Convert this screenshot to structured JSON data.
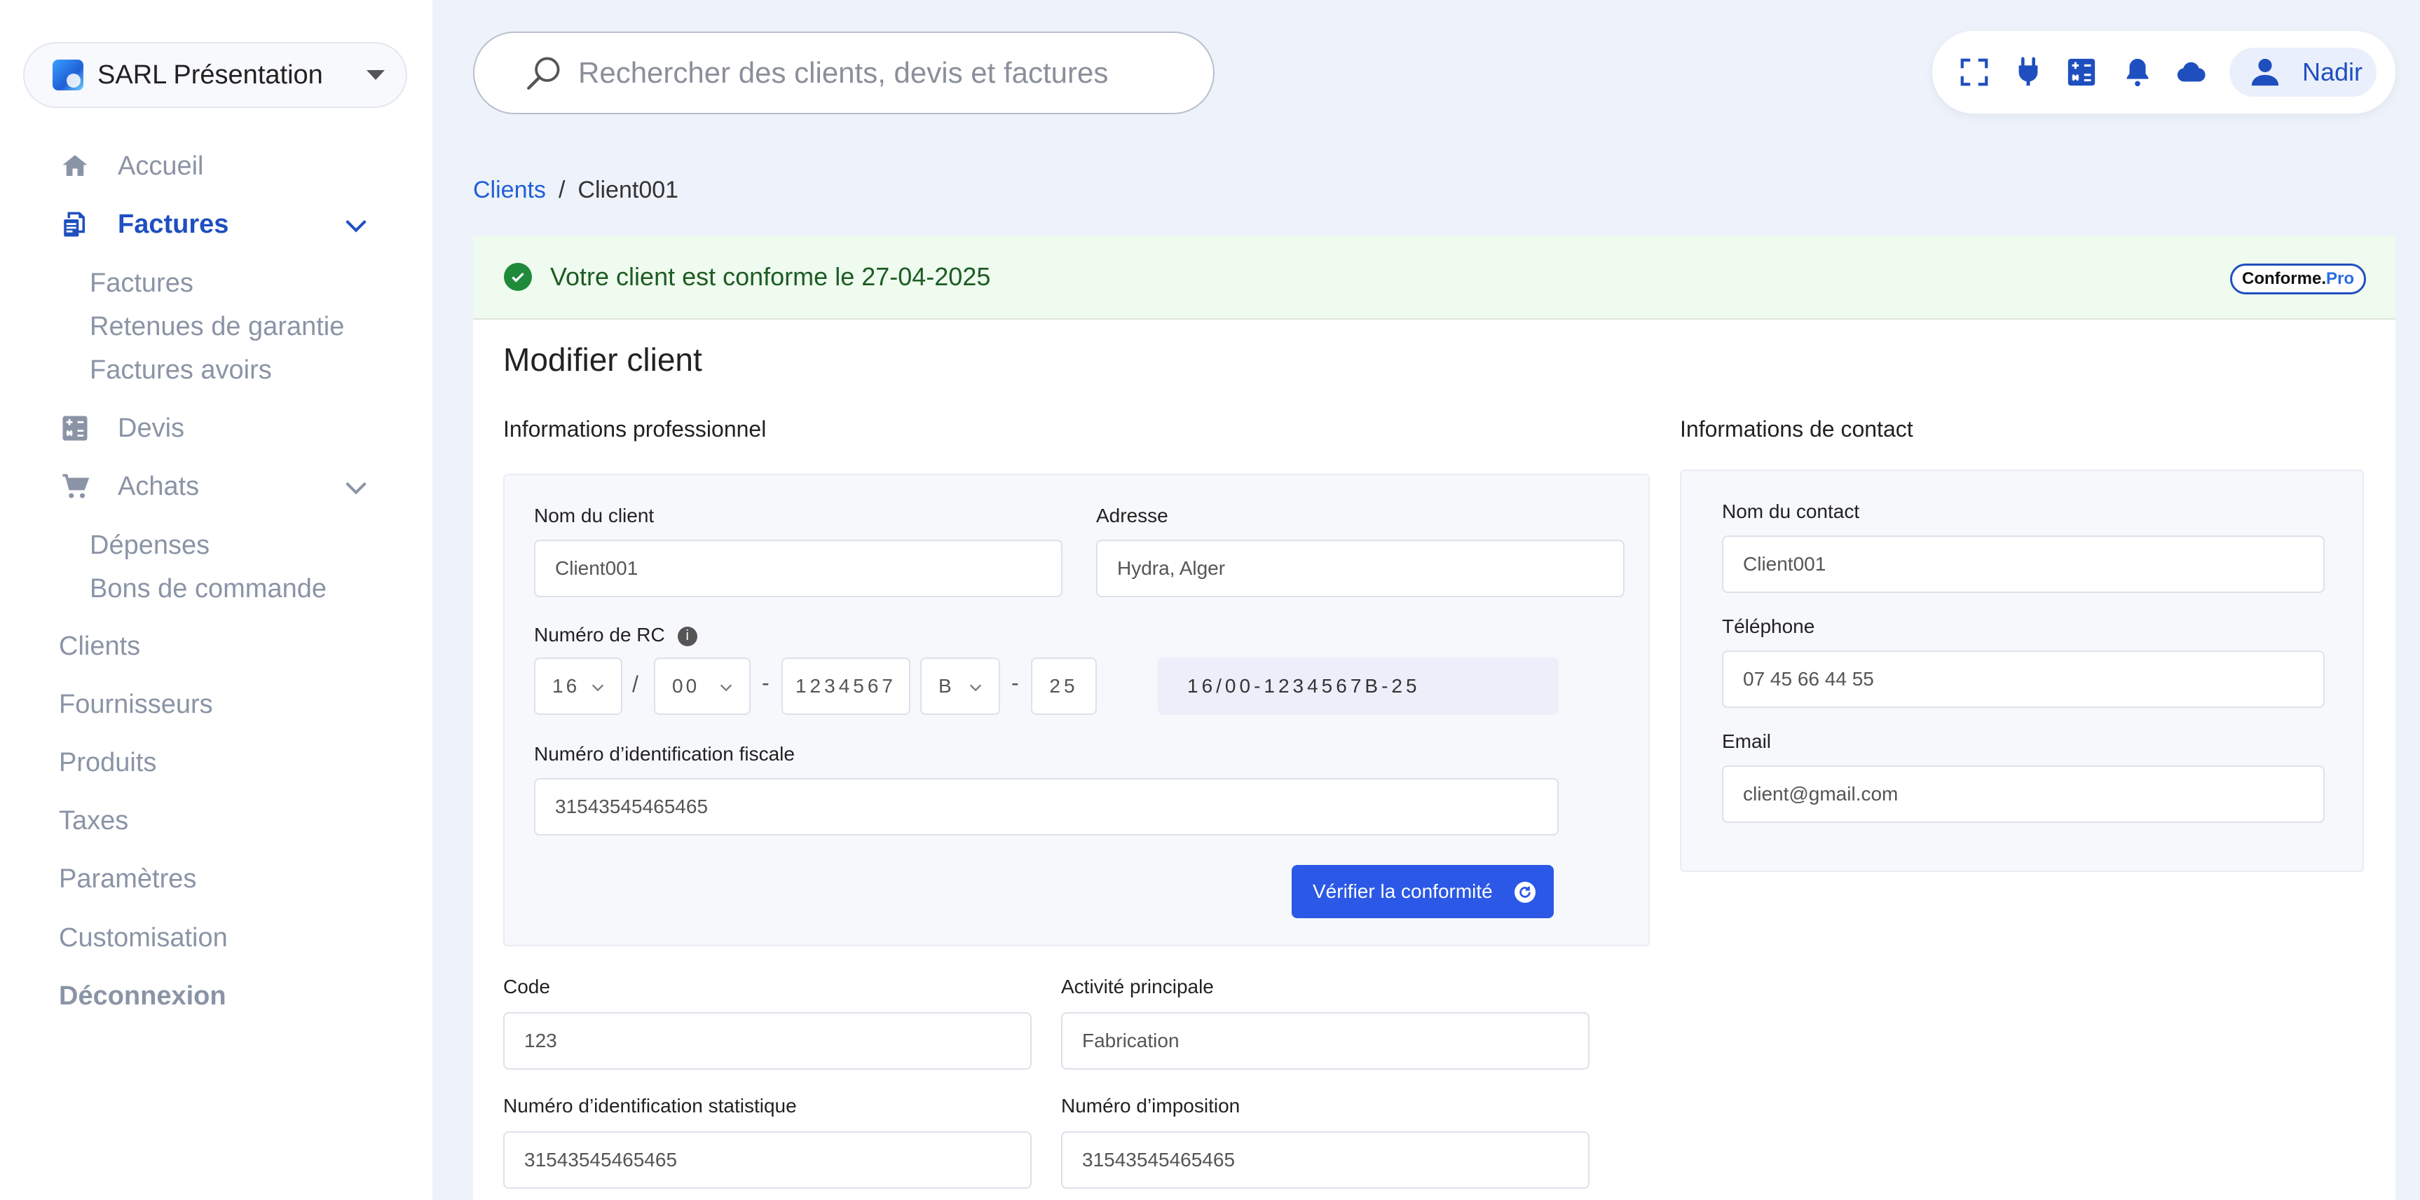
{
  "sidebar": {
    "company": "SARL Présentation",
    "items": {
      "accueil": "Accueil",
      "factures": "Factures",
      "devis": "Devis",
      "achats": "Achats"
    },
    "factures_sub": [
      "Factures",
      "Retenues de garantie",
      "Factures avoirs"
    ],
    "achats_sub": [
      "Dépenses",
      "Bons de commande"
    ],
    "plain": [
      "Clients",
      "Fournisseurs",
      "Produits",
      "Taxes",
      "Paramètres",
      "Customisation"
    ],
    "logout": "Déconnexion"
  },
  "search": {
    "placeholder": "Rechercher des clients, devis et factures"
  },
  "toolbar": {
    "icons": [
      "fullscreen-icon",
      "plug-icon",
      "calculator-icon",
      "bell-icon",
      "cloud-icon",
      "user-icon"
    ],
    "user": "Nadir"
  },
  "breadcrumb": {
    "parent": "Clients",
    "separator": "/",
    "current": "Client001"
  },
  "banner": {
    "message": "Votre client est conforme le 27-04-2025",
    "badge_a": "Conforme.",
    "badge_b": "Pro"
  },
  "form": {
    "title": "Modifier client",
    "pro_section": "Informations professionnel",
    "contact_section": "Informations de contact",
    "nom_client_label": "Nom du client",
    "nom_client_value": "Client001",
    "adresse_label": "Adresse",
    "adresse_value": "Hydra, Alger",
    "rc_label": "Numéro de RC",
    "rc": {
      "wilaya": "16",
      "sep1": "/",
      "type": "00",
      "sep2": "-",
      "number": "1234567",
      "letter": "B",
      "sep3": "-",
      "year": "25",
      "result": "16/00-1234567B-25"
    },
    "nif_label": "Numéro d’identification fiscale",
    "nif_value": "31543545465465",
    "verify_button": "Vérifier la conformité",
    "code_label": "Code",
    "code_value": "123",
    "activite_label": "Activité principale",
    "activite_value": "Fabrication",
    "nis_label": "Numéro d’identification statistique",
    "nis_value": "31543545465465",
    "imposition_label": "Numéro d’imposition",
    "imposition_value": "31543545465465",
    "contact_name_label": "Nom du contact",
    "contact_name_value": "Client001",
    "phone_label": "Téléphone",
    "phone_value": "07 45 66 44 55",
    "email_label": "Email",
    "email_value": "client@gmail.com"
  },
  "colors": {
    "accent": "#1f4fbf",
    "button": "#2b58e6",
    "success_bg": "#effbee",
    "success_text": "#1d5c24"
  }
}
